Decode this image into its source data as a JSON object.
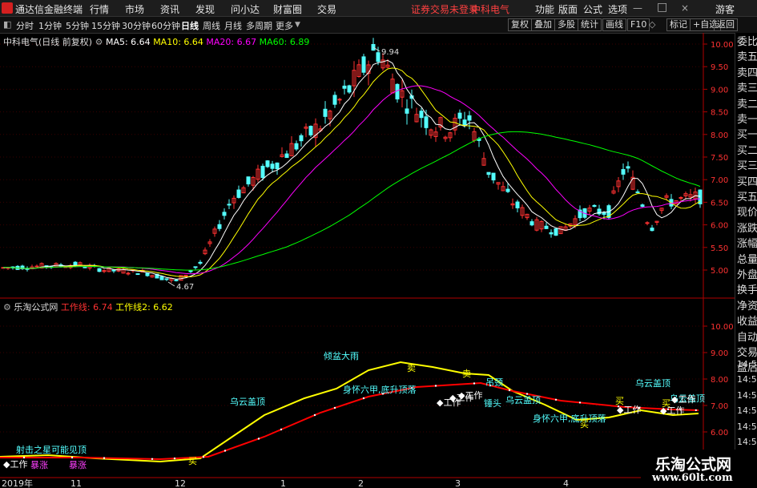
{
  "menubar": {
    "app_title": "通达信金融终端",
    "menus": [
      "行情",
      "市场",
      "资讯",
      "发现",
      "问小达",
      "财富圈",
      "交易"
    ],
    "login_warning": "证券交易未登录",
    "stock_name": "中科电气",
    "right_menus": [
      "功能",
      "版面",
      "公式",
      "选项"
    ],
    "user": "游客"
  },
  "toolbar": {
    "periods": [
      "分时",
      "1分钟",
      "5分钟",
      "15分钟",
      "30分钟",
      "60分钟",
      "日线",
      "周线",
      "月线",
      "多周期",
      "更多"
    ],
    "active_period": "日线",
    "buttons": [
      "复权",
      "叠加",
      "多股",
      "统计",
      "画线",
      "F10",
      "标记",
      "+自选",
      "返回"
    ]
  },
  "main_chart": {
    "header": "中科电气(日线 前复权)",
    "ma": [
      {
        "label": "MA5: 6.64",
        "color": "#ffffff"
      },
      {
        "label": "MA10: 6.64",
        "color": "#ffff00"
      },
      {
        "label": "MA20: 6.67",
        "color": "#ff00ff"
      },
      {
        "label": "MA60: 6.89",
        "color": "#00ff00"
      }
    ],
    "price_ticks": [
      "10.00",
      "9.50",
      "9.00",
      "8.50",
      "8.00",
      "7.50",
      "7.00",
      "6.50",
      "6.00",
      "5.50",
      "5.00"
    ],
    "high_label": "9.94",
    "low_label": "4.67",
    "colors": {
      "up": "#ff3232",
      "down": "#54ffff",
      "ma5": "#ffffff",
      "ma10": "#ffff00",
      "ma20": "#ff00ff",
      "ma60": "#00ff00"
    }
  },
  "sub_chart": {
    "header": "乐淘公式网",
    "line1": "工作线: 6.74",
    "line2": "工作线2: 6.62",
    "ticks": [
      "10.00",
      "9.00",
      "8.00",
      "7.00",
      "6.00"
    ],
    "annotations": {
      "a1": "射击之星可能见顶",
      "a2": "乌云盖顶",
      "a3": "倾盆大雨",
      "a4": "身怀六甲,底升顶落",
      "a5": "吊颈",
      "a6": "锤头",
      "a7": "乌云盖顶",
      "a8": "乌云盖顶",
      "a9": "乌云盖顶",
      "a10": "身怀六甲,底升顶落",
      "a11": "暴涨",
      "a12": "暴涨",
      "work": "工作",
      "buy": "买",
      "sell": "卖"
    }
  },
  "xaxis": [
    "2019年",
    "11",
    "12",
    "1",
    "2",
    "3",
    "4"
  ],
  "right_panel": [
    "委比",
    "卖五",
    "卖四",
    "卖三",
    "卖二",
    "卖一",
    "买一",
    "买二",
    "买三",
    "买四",
    "买五",
    "现价",
    "涨跌",
    "涨幅",
    "总量",
    "外盘",
    "换手",
    "净资",
    "收益",
    "自动",
    "交易",
    "盘后"
  ],
  "right_times": [
    "14:56",
    "14:56",
    "14:56",
    "14:56",
    "14:56",
    "14:56",
    "14:56"
  ],
  "watermark": {
    "title": "乐淘公式网",
    "url": "www.60lt.com"
  }
}
